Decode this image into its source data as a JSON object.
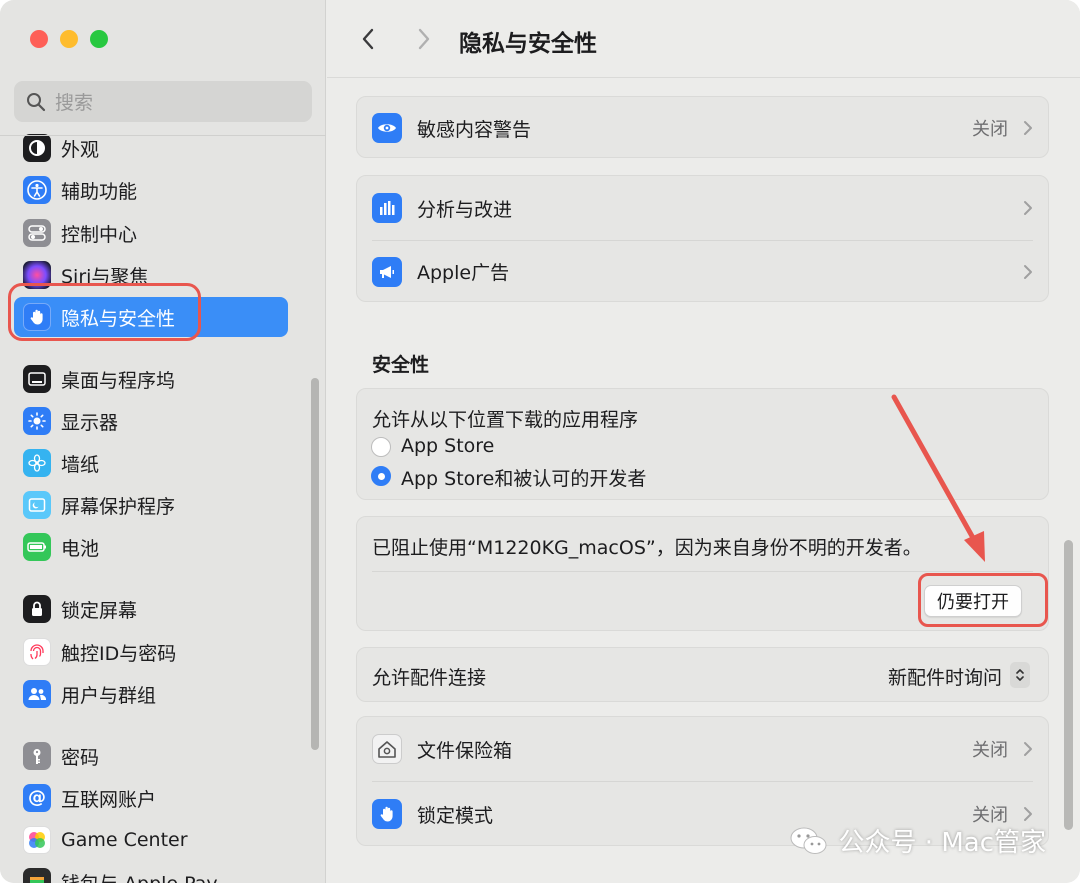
{
  "window": {
    "title": "隐私与安全性"
  },
  "sidebar": {
    "search_placeholder": "搜索",
    "items": [
      {
        "label": "外观",
        "icon": "appearance-icon"
      },
      {
        "label": "辅助功能",
        "icon": "accessibility-icon"
      },
      {
        "label": "控制中心",
        "icon": "control-center-icon"
      },
      {
        "label": "Siri与聚焦",
        "icon": "siri-icon"
      },
      {
        "label": "隐私与安全性",
        "icon": "privacy-hand-icon",
        "selected": true
      },
      {
        "label": "桌面与程序坞",
        "icon": "desktop-dock-icon"
      },
      {
        "label": "显示器",
        "icon": "display-icon"
      },
      {
        "label": "墙纸",
        "icon": "wallpaper-icon"
      },
      {
        "label": "屏幕保护程序",
        "icon": "screensaver-icon"
      },
      {
        "label": "电池",
        "icon": "battery-icon"
      },
      {
        "label": "锁定屏幕",
        "icon": "lock-screen-icon"
      },
      {
        "label": "触控ID与密码",
        "icon": "touch-id-icon"
      },
      {
        "label": "用户与群组",
        "icon": "users-groups-icon"
      },
      {
        "label": "密码",
        "icon": "key-icon"
      },
      {
        "label": "互联网账户",
        "icon": "at-icon"
      },
      {
        "label": "Game Center",
        "icon": "game-center-icon"
      },
      {
        "label": "钱包与 Apple Pay",
        "icon": "wallet-icon"
      }
    ]
  },
  "main": {
    "rows": {
      "sensitive_content": {
        "label": "敏感内容警告",
        "value": "关闭"
      },
      "analytics": {
        "label": "分析与改进"
      },
      "apple_ads": {
        "label": "Apple广告"
      }
    },
    "security": {
      "section_title": "安全性",
      "download_label": "允许从以下位置下载的应用程序",
      "option_app_store": "App Store",
      "option_app_store_devs": "App Store和被认可的开发者",
      "blocked_message": "已阻止使用“M1220KG_macOS”，因为来自身份不明的开发者。",
      "open_anyway_button": "仍要打开",
      "accessories_label": "允许配件连接",
      "accessories_value": "新配件时询问",
      "filevault": {
        "label": "文件保险箱",
        "value": "关闭"
      },
      "lockdown": {
        "label": "锁定模式",
        "value": "关闭"
      }
    }
  },
  "watermark": {
    "text": "公众号 · Mac管家"
  },
  "colors": {
    "accent": "#3a8ef7",
    "annotation_red": "#e8564e"
  }
}
